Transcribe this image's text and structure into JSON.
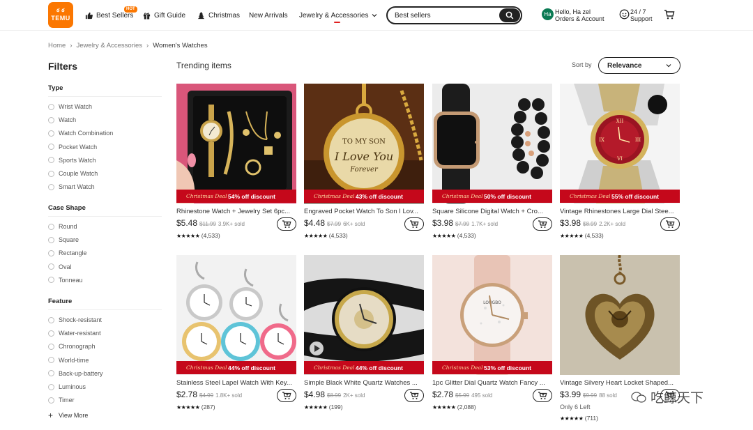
{
  "header": {
    "logo_line1": "ఠ ఠ",
    "logo_line2": "TEMU",
    "nav": [
      {
        "label": "Best Sellers",
        "icon": "thumbs-up-icon"
      },
      {
        "label": "Gift Guide",
        "icon": "gift-icon"
      },
      {
        "label": "Christmas",
        "icon": "tree-icon"
      },
      {
        "label": "New Arrivals"
      },
      {
        "label": "Jewelry & Accessories",
        "icon": "chevron-down-icon"
      }
    ],
    "hot_badge": "HOT",
    "search_value": "Best sellers",
    "avatar_initials": "Ha",
    "account_line1": "Hello, Ha zel",
    "account_line2": "Orders & Account",
    "support_line1": "24 / 7",
    "support_line2": "Support"
  },
  "breadcrumb": [
    "Home",
    "Jewelry & Accessories",
    "Women's Watches"
  ],
  "sidebar": {
    "title": "Filters",
    "sections": [
      {
        "title": "Type",
        "items": [
          "Wrist Watch",
          "Watch",
          "Watch Combination",
          "Pocket Watch",
          "Sports Watch",
          "Couple Watch",
          "Smart Watch"
        ]
      },
      {
        "title": "Case Shape",
        "items": [
          "Round",
          "Square",
          "Rectangle",
          "Oval",
          "Tonneau"
        ]
      },
      {
        "title": "Feature",
        "items": [
          "Shock-resistant",
          "Water-resistant",
          "Chronograph",
          "World-time",
          "Back-up-battery",
          "Luminous",
          "Timer"
        ]
      }
    ],
    "view_more": "View More"
  },
  "main": {
    "heading": "Trending items",
    "sort_label": "Sort by",
    "sort_value": "Relevance"
  },
  "deal_tag": "Christmas Deal",
  "products": [
    {
      "title": "Rhinestone Watch + Jewelry Set 6pc...",
      "price": "$5.48",
      "orig": "$11.99",
      "sold": "3.9K+ sold",
      "discount": "54% off discount",
      "stars": "★★★★★",
      "reviews": "(4,533)"
    },
    {
      "title": "Engraved Pocket Watch To Son I Lov...",
      "price": "$4.48",
      "orig": "$7.99",
      "sold": "6K+ sold",
      "discount": "43% off discount",
      "stars": "★★★★★",
      "reviews": "(4,533)"
    },
    {
      "title": "Square Silicone Digital Watch + Cro...",
      "price": "$3.98",
      "orig": "$7.99",
      "sold": "1.7K+ sold",
      "discount": "50% off discount",
      "stars": "★★★★★",
      "reviews": "(4,533)"
    },
    {
      "title": "Vintage Rhinestones Large Dial Stee...",
      "price": "$3.98",
      "orig": "$8.99",
      "sold": "2.2K+ sold",
      "discount": "55% off discount",
      "stars": "★★★★★",
      "reviews": "(4,533)"
    },
    {
      "title": "Stainless Steel Lapel Watch With Key...",
      "price": "$2.78",
      "orig": "$4.99",
      "sold": "1.8K+ sold",
      "discount": "44% off discount",
      "stars": "★★★★★",
      "reviews": "(287)"
    },
    {
      "title": "Simple Black White Quartz Watches ...",
      "price": "$4.98",
      "orig": "$8.99",
      "sold": "2K+ sold",
      "discount": "44% off discount",
      "stars": "★★★★★",
      "reviews": "(199)"
    },
    {
      "title": "1pc Glitter Dial Quartz Watch Fancy ...",
      "price": "$2.78",
      "orig": "$5.99",
      "sold": "495 sold",
      "discount": "53% off discount",
      "stars": "★★★★★",
      "reviews": "(2,088)"
    },
    {
      "title": "Vintage Silvery Heart Locket Shaped...",
      "price": "$3.99",
      "orig": "$9.99",
      "sold": "88 sold",
      "extra": "Only 6 Left",
      "stars": "★★★★★",
      "reviews": "(711)"
    }
  ],
  "watermark": "吃鲸天下",
  "colors": {
    "brand": "#fb7701",
    "deal": "#c5081b"
  }
}
